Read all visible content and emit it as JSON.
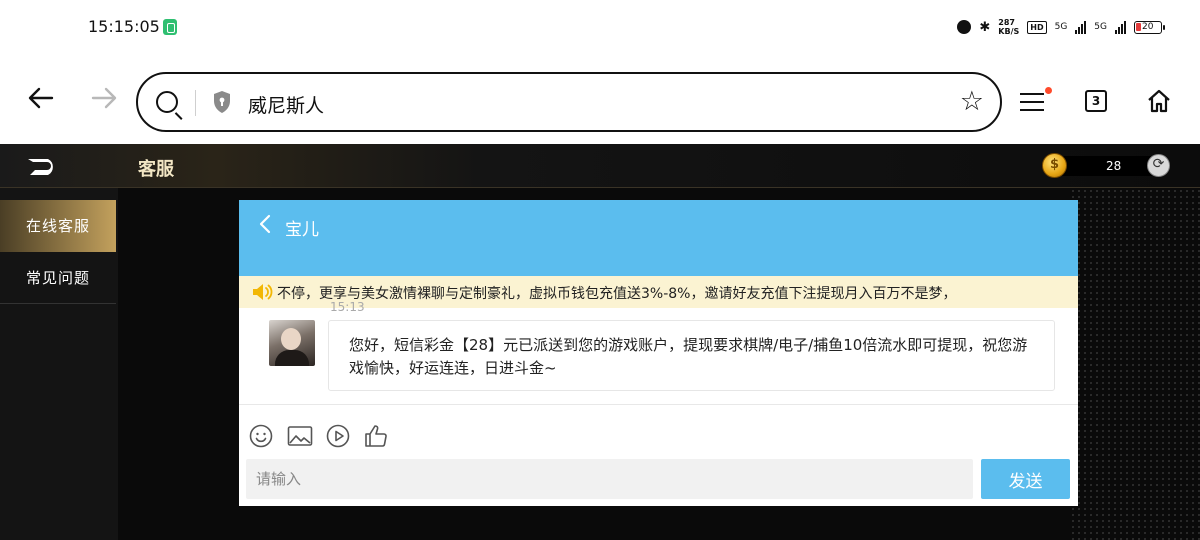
{
  "status_bar": {
    "time": "15:15:05",
    "net_speed_value": "287",
    "net_speed_unit": "KB/S",
    "hd_badge": "HD",
    "signal_1": "5G",
    "signal_2": "5G",
    "battery_level": "20",
    "battery_fraction": 0.2,
    "battery_color": "#e23b3b"
  },
  "browser": {
    "url_text": "威尼斯人",
    "tab_count": "3",
    "menu_badge_color": "#ff4a2b"
  },
  "app": {
    "header_title": "客服",
    "coin_symbol": "$",
    "coin_balance": "28",
    "accent_gold": "#c3a15d",
    "sidebar": {
      "items": [
        {
          "label": "在线客服",
          "active": true
        },
        {
          "label": "常见问题",
          "active": false
        }
      ]
    }
  },
  "chat": {
    "agent_name": "宝儿",
    "marquee_text": "不停，更享与美女激情裸聊与定制豪礼，虚拟币钱包充值送3%-8%，邀请好友充值下注提现月入百万不是梦，",
    "message_time": "15:13",
    "message_text": "您好，短信彩金【28】元已派送到您的游戏账户，提现要求棋牌/电子/捕鱼10倍流水即可提现，祝您游戏愉快，好运连连，日进斗金~",
    "input_placeholder": "请输入",
    "send_label": "发送",
    "header_color": "#5bbdee",
    "toolbar_icons": [
      "emoji-icon",
      "image-icon",
      "video-icon",
      "thumbs-up-icon"
    ]
  }
}
